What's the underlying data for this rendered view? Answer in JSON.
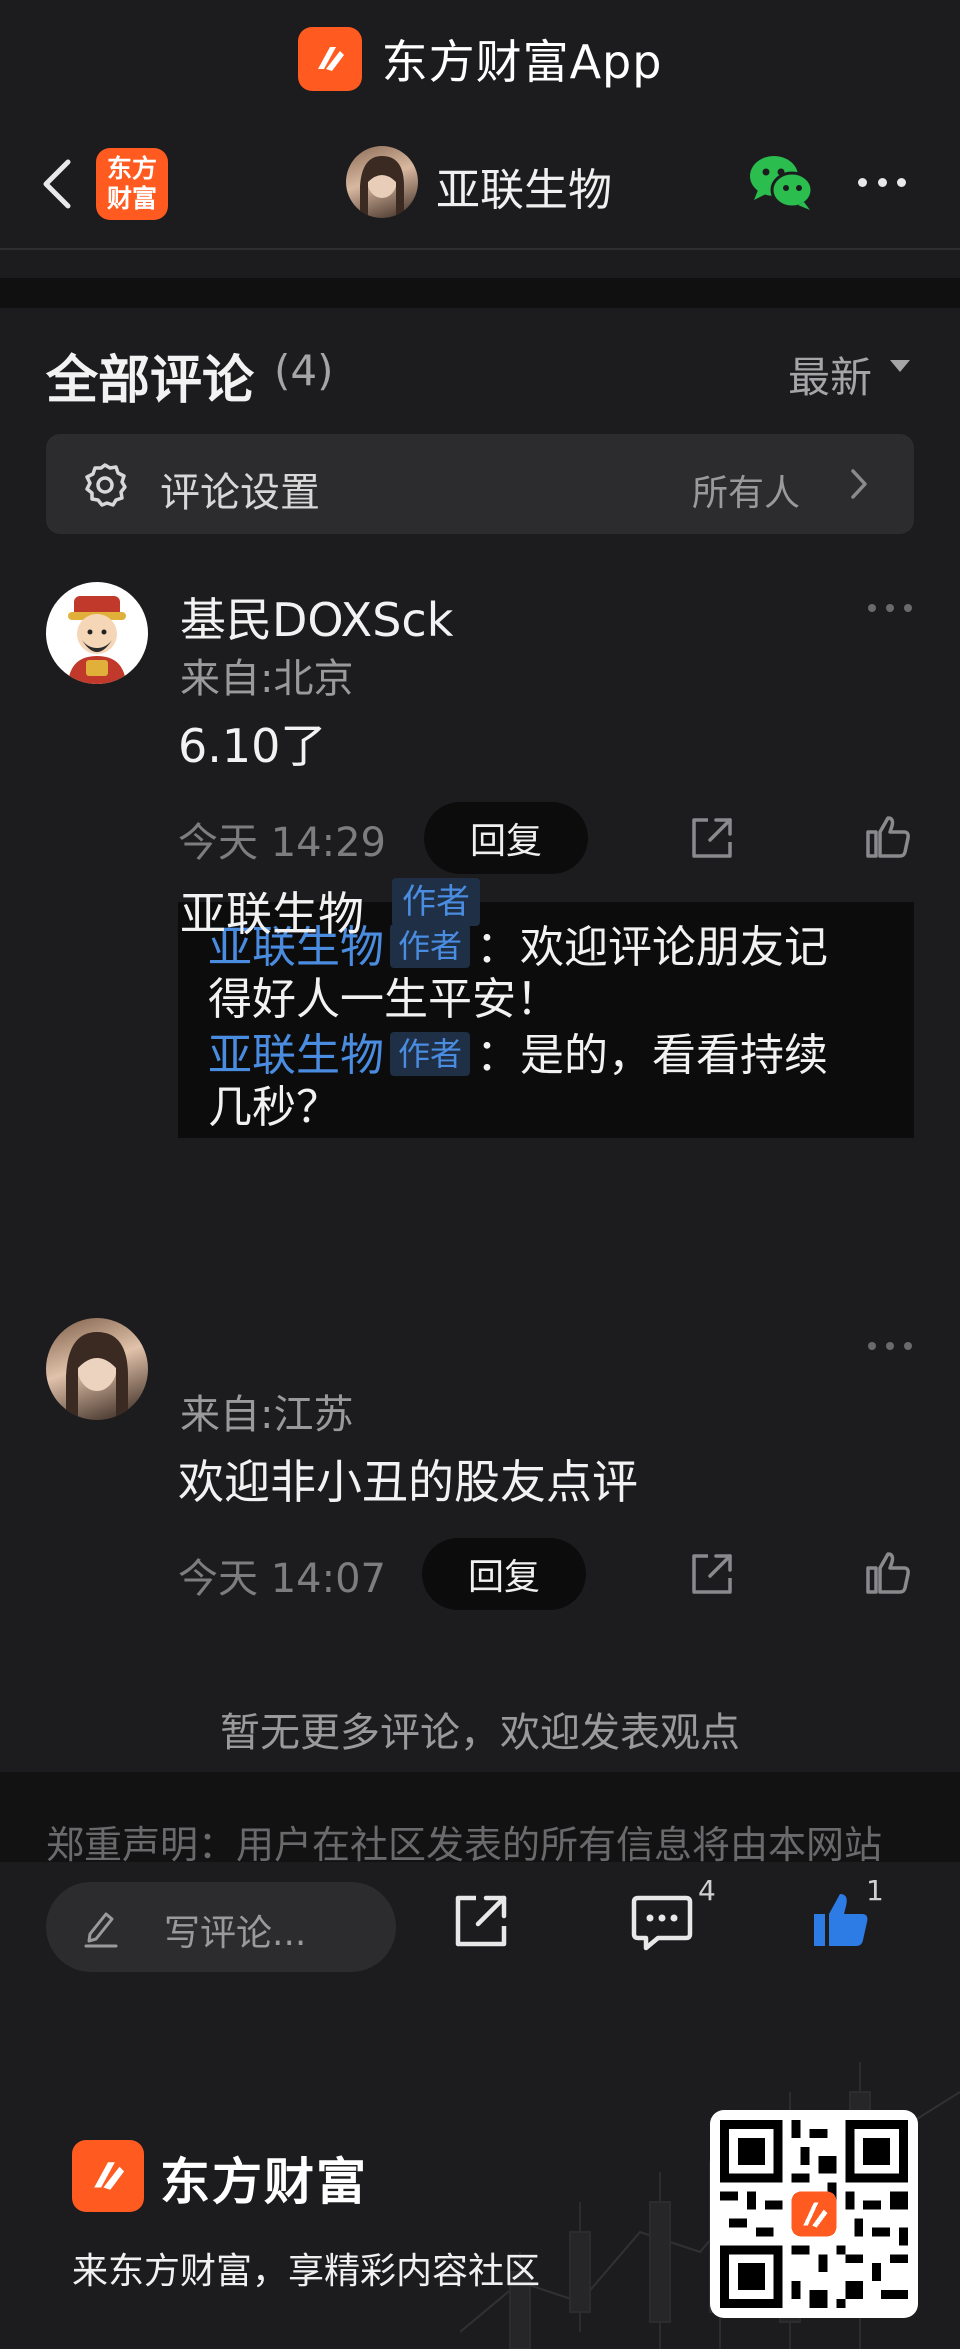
{
  "app_banner": {
    "title": "东方财富App"
  },
  "header": {
    "brand_badge_line1": "东方",
    "brand_badge_line2": "财富",
    "title": "亚联生物"
  },
  "comments_section": {
    "title": "全部评论",
    "count": "(4)",
    "sort_label": "最新",
    "settings": {
      "label": "评论设置",
      "value": "所有人"
    },
    "comments": [
      {
        "username": "基民DOXSck",
        "location": "来自:北京",
        "text": "6.10了",
        "time": "今天 14:29",
        "reply_button": "回复",
        "replies": [
          {
            "name": "亚联生物",
            "tag": "作者",
            "sep": "：",
            "text_line1": "欢迎评论朋友记",
            "text_line2": "得好人一生平安！"
          },
          {
            "name": "亚联生物",
            "tag": "作者",
            "sep": "：",
            "text_line1": "是的，看看持续",
            "text_line2": "几秒？"
          }
        ]
      },
      {
        "username": "亚联生物",
        "tag": "作者",
        "location": "来自:江苏",
        "text": "欢迎非小丑的股友点评",
        "time": "今天 14:07",
        "reply_button": "回复"
      }
    ],
    "no_more": "暂无更多评论，欢迎发表观点"
  },
  "disclaimer": "郑重声明：用户在社区发表的所有信息将由本网站",
  "bottom_bar": {
    "write_placeholder": "写评论...",
    "comment_count": "4",
    "like_count": "1"
  },
  "promo": {
    "brand": "东方财富",
    "slogan": "来东方财富，享精彩内容社区"
  },
  "colors": {
    "accent_orange": "#ff5a1f",
    "link_blue": "#4a8ce0",
    "like_blue": "#2d7be5",
    "wechat_green": "#2bbd4e",
    "background": "#1c1c1e"
  },
  "icons": [
    "back-icon",
    "wechat-icon",
    "more-icon",
    "gear-icon",
    "chevron-right-icon",
    "share-icon",
    "thumbs-up-icon",
    "pencil-icon",
    "comment-icon",
    "qr-code"
  ]
}
